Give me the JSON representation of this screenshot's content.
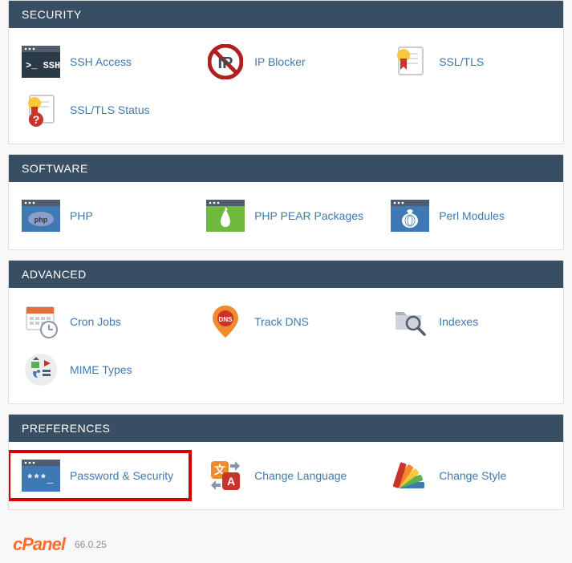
{
  "sections": [
    {
      "key": "security",
      "title": "SECURITY",
      "items": [
        {
          "key": "ssh-access",
          "label": "SSH Access"
        },
        {
          "key": "ip-blocker",
          "label": "IP Blocker"
        },
        {
          "key": "ssl-tls",
          "label": "SSL/TLS"
        },
        {
          "key": "ssl-tls-status",
          "label": "SSL/TLS Status"
        }
      ]
    },
    {
      "key": "software",
      "title": "SOFTWARE",
      "items": [
        {
          "key": "php",
          "label": "PHP"
        },
        {
          "key": "php-pear",
          "label": "PHP PEAR Packages"
        },
        {
          "key": "perl-modules",
          "label": "Perl Modules"
        }
      ]
    },
    {
      "key": "advanced",
      "title": "ADVANCED",
      "items": [
        {
          "key": "cron-jobs",
          "label": "Cron Jobs"
        },
        {
          "key": "track-dns",
          "label": "Track DNS"
        },
        {
          "key": "indexes",
          "label": "Indexes"
        },
        {
          "key": "mime-types",
          "label": "MIME Types"
        }
      ]
    },
    {
      "key": "preferences",
      "title": "PREFERENCES",
      "items": [
        {
          "key": "password-security",
          "label": "Password & Security",
          "highlighted": true
        },
        {
          "key": "change-language",
          "label": "Change Language"
        },
        {
          "key": "change-style",
          "label": "Change Style"
        }
      ]
    }
  ],
  "footer": {
    "brand": "cPanel",
    "version": "66.0.25"
  }
}
